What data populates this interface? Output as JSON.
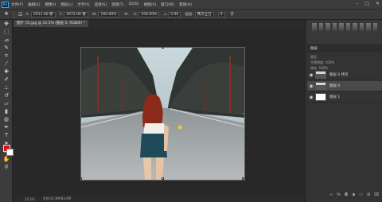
{
  "app": {
    "logo": "Ps",
    "menus": [
      "文件(F)",
      "编辑(E)",
      "图像(I)",
      "图层(L)",
      "文字(Y)",
      "选择(S)",
      "滤镜(T)",
      "3D(D)",
      "视图(V)",
      "窗口(W)",
      "帮助(H)"
    ],
    "window_buttons": [
      "–",
      "□",
      "✕"
    ]
  },
  "options": {
    "x_label": "X:",
    "x_value": "2011.00 像",
    "y_label": "Y:",
    "y_value": "2672.00 像",
    "w_label": "W:",
    "w_value": "100.00%",
    "h_label": "H:",
    "h_value": "100.00%",
    "angle_label": "⊿",
    "angle_value": "0.00",
    "interp_label": "插值:",
    "interp_value": "两次立方",
    "misc_value": "0"
  },
  "document": {
    "tab_label": "图片 (5).jpg @ 12.5% (图层 0, RGB/8) *"
  },
  "status": {
    "zoom": "12.5%",
    "doc_info": "文档:41.8M/83.6M"
  },
  "layers_panel": {
    "title": "图层",
    "kind_label": "类型",
    "opacity_label": "不透明度: 100%",
    "fill_label": "填充: 100%",
    "layers": [
      {
        "name": "图层 0 拷贝"
      },
      {
        "name": "图层 0"
      },
      {
        "name": "图层 1"
      }
    ]
  },
  "colors": {
    "foreground": "#e01010",
    "background": "#ffffff",
    "accent": "#31a8ff"
  },
  "icons": {
    "move": "move-icon",
    "eye": "eye-icon"
  }
}
